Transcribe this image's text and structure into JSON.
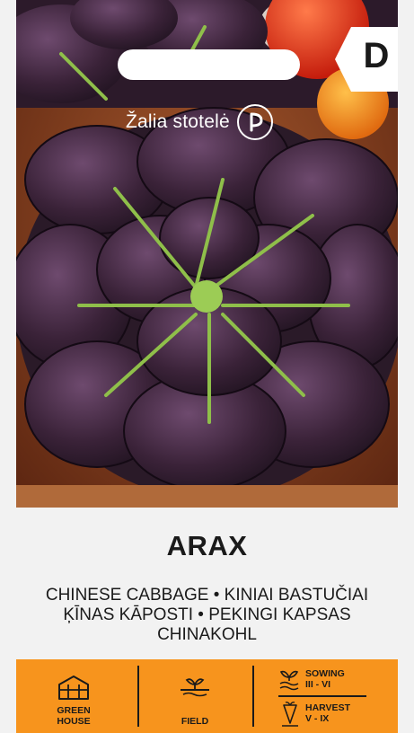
{
  "brand": {
    "name": "Žalia stotelė",
    "logo_icon": "zalia-stotele-logo-icon"
  },
  "badge": {
    "letter": "D"
  },
  "product": {
    "title": "ARAX",
    "names": [
      "CHINESE CABBAGE • KINIAI BASTUČIAI",
      "ĶĪNAS KĀPOSTI • PEKINGI KAPSAS",
      "CHINAKOHL"
    ]
  },
  "info_bar": {
    "color": "#f7941d",
    "greenhouse": {
      "line1": "GREEN",
      "line2": "HOUSE",
      "icon": "greenhouse-icon"
    },
    "field": {
      "label": "FIELD",
      "icon": "field-icon"
    },
    "sowing": {
      "label": "SOWING",
      "months": "III - VI",
      "icon": "sowing-icon"
    },
    "harvest": {
      "label": "HARVEST",
      "months": "V - IX",
      "icon": "harvest-icon"
    }
  }
}
